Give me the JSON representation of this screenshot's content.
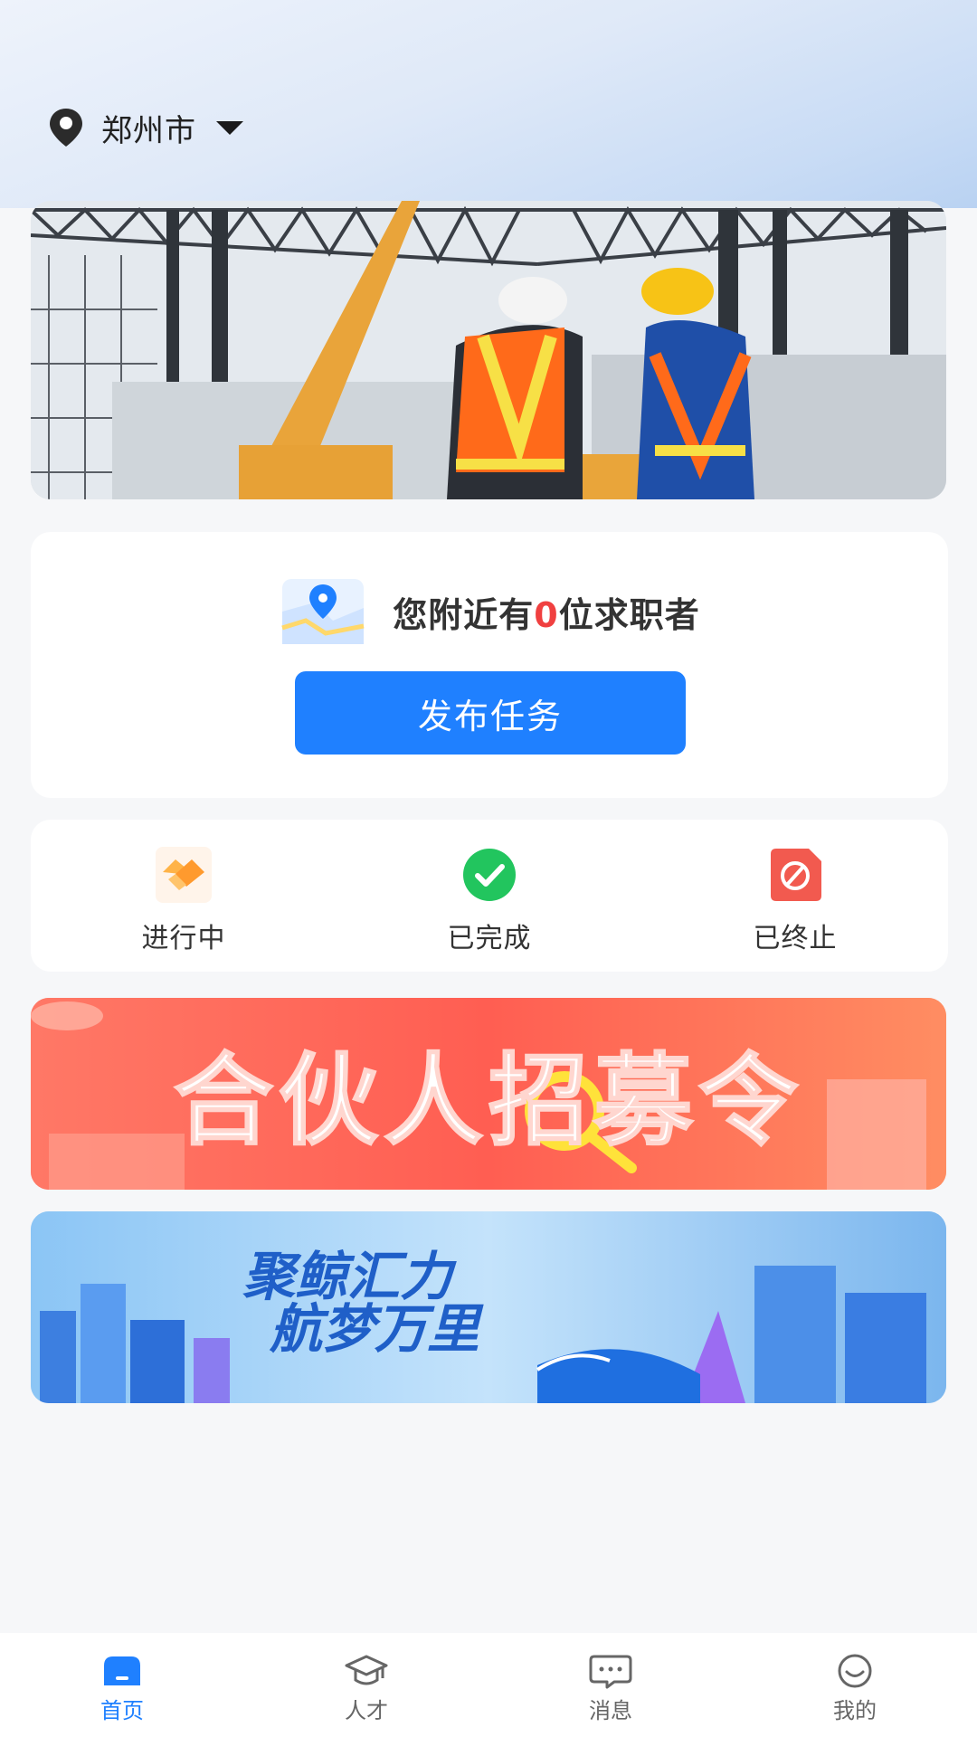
{
  "header": {
    "city": "郑州市",
    "pin_icon": "location-pin-icon",
    "caret_icon": "caret-down-icon"
  },
  "banner_top": {
    "image": "construction-workers-photo"
  },
  "nearby": {
    "prefix": "您附近有",
    "count": "0",
    "suffix": "位求职者",
    "map_icon": "map-location-icon",
    "count_color": "#f04040"
  },
  "publish_button": {
    "label": "发布任务",
    "color": "#1f80ff"
  },
  "status": [
    {
      "label": "进行中",
      "icon": "handshake-icon",
      "color": "#ffa23a"
    },
    {
      "label": "已完成",
      "icon": "check-circle-icon",
      "color": "#22c55e"
    },
    {
      "label": "已终止",
      "icon": "stop-document-icon",
      "color": "#f25a4f"
    }
  ],
  "promo1": {
    "title": "合伙人招募令"
  },
  "promo2": {
    "line1": "聚鲸汇力",
    "line2": "航梦万里"
  },
  "tabbar": {
    "active_color": "#1f80ff",
    "items": [
      {
        "label": "首页",
        "icon": "home-icon",
        "active": true
      },
      {
        "label": "人才",
        "icon": "graduation-cap-icon",
        "active": false
      },
      {
        "label": "消息",
        "icon": "message-icon",
        "active": false
      },
      {
        "label": "我的",
        "icon": "smile-icon",
        "active": false
      }
    ]
  }
}
